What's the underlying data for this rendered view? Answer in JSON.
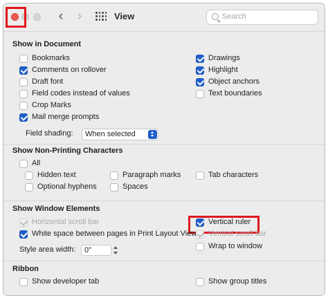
{
  "titlebar": {
    "title": "View",
    "search_placeholder": "Search",
    "icons": [
      "close-button",
      "minimize-button",
      "zoom-button",
      "chevron-left-icon",
      "chevron-right-icon",
      "grid-icon",
      "search-icon"
    ],
    "back_glyph": "‹",
    "forward_glyph": "›"
  },
  "show_in_document": {
    "title": "Show in Document",
    "left": [
      {
        "label": "Bookmarks",
        "checked": false
      },
      {
        "label": "Comments on rollover",
        "checked": true
      },
      {
        "label": "Draft font",
        "checked": false
      },
      {
        "label": "Field codes instead of values",
        "checked": false
      },
      {
        "label": "Crop Marks",
        "checked": false
      },
      {
        "label": "Mail merge prompts",
        "checked": true
      }
    ],
    "right": [
      {
        "label": "Drawings",
        "checked": true
      },
      {
        "label": "Highlight",
        "checked": true
      },
      {
        "label": "Object anchors",
        "checked": true
      },
      {
        "label": "Text boundaries",
        "checked": false
      }
    ],
    "field_shading_label": "Field shading:",
    "field_shading_value": "When selected"
  },
  "non_printing": {
    "title": "Show Non-Printing Characters",
    "all": {
      "label": "All",
      "checked": false
    },
    "items": [
      {
        "label": "Hidden text",
        "checked": false
      },
      {
        "label": "Paragraph marks",
        "checked": false
      },
      {
        "label": "Tab characters",
        "checked": false
      },
      {
        "label": "Optional hyphens",
        "checked": false
      },
      {
        "label": "Spaces",
        "checked": false
      }
    ]
  },
  "window_elements": {
    "title": "Show Window Elements",
    "horizontal_scroll_bar": {
      "label": "Horizontal scroll bar",
      "checked": true,
      "disabled": true
    },
    "vertical_ruler": {
      "label": "Vertical ruler",
      "checked": true
    },
    "white_space": {
      "label": "White space between pages in Print Layout View",
      "checked": true
    },
    "vertical_scroll_bar": {
      "label": "Vertical scroll bar",
      "checked": true,
      "disabled": true
    },
    "style_area_width_label": "Style area width:",
    "style_area_width_value": "0\"",
    "wrap_to_window": {
      "label": "Wrap to window",
      "checked": false
    }
  },
  "ribbon": {
    "title": "Ribbon",
    "developer_tab": {
      "label": "Show developer tab",
      "checked": false
    },
    "group_titles": {
      "label": "Show group titles",
      "checked": false
    }
  },
  "colors": {
    "accent": "#1f5fc9",
    "callout": "#e0161d",
    "close_light": "#ee5a52"
  }
}
